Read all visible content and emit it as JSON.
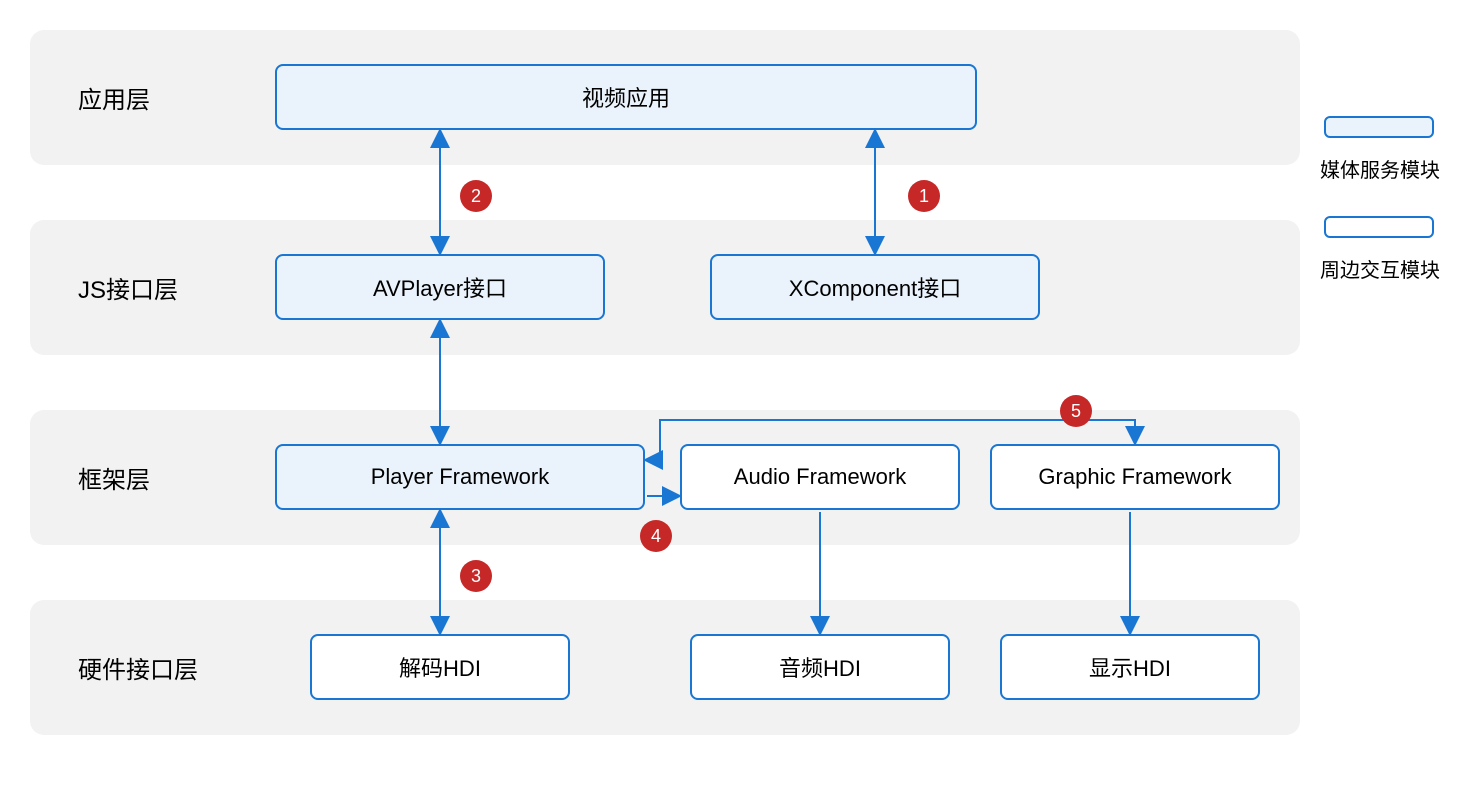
{
  "layers": {
    "app": "应用层",
    "js": "JS接口层",
    "framework": "框架层",
    "hardware": "硬件接口层"
  },
  "boxes": {
    "videoApp": "视频应用",
    "avplayer": "AVPlayer接口",
    "xcomponent": "XComponent接口",
    "playerFw": "Player Framework",
    "audioFw": "Audio Framework",
    "graphicFw": "Graphic Framework",
    "decodeHdi": "解码HDI",
    "audioHdi": "音频HDI",
    "displayHdi": "显示HDI"
  },
  "badges": {
    "b1": "1",
    "b2": "2",
    "b3": "3",
    "b4": "4",
    "b5": "5"
  },
  "legend": {
    "media": "媒体服务模块",
    "peripheral": "周边交互模块"
  }
}
